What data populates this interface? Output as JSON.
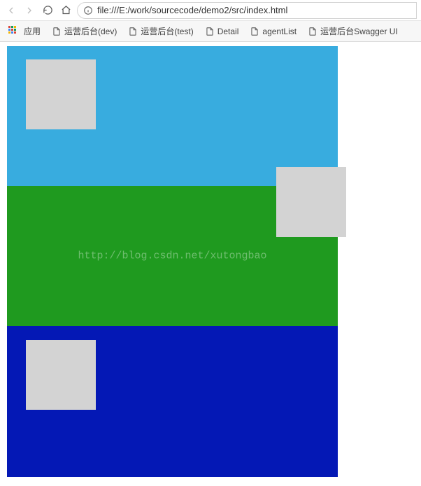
{
  "toolbar": {
    "url": "file:///E:/work/sourcecode/demo2/src/index.html"
  },
  "bookmarks_bar": {
    "apps_label": "应用",
    "items": [
      {
        "label": "运营后台(dev)"
      },
      {
        "label": "运营后台(test)"
      },
      {
        "label": "Detail"
      },
      {
        "label": "agentList"
      },
      {
        "label": "运营后台Swagger UI"
      }
    ]
  },
  "page": {
    "watermark": "http://blog.csdn.net/xutongbao",
    "bands": [
      {
        "color": "#38acdf"
      },
      {
        "color": "#1f9a1f"
      },
      {
        "color": "#0418b5"
      }
    ],
    "box_color": "#d3d3d3"
  }
}
